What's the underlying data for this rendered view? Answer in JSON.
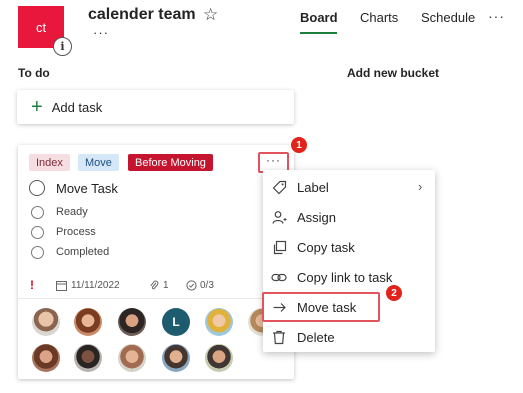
{
  "plan": {
    "initials": "ct",
    "info_glyph": "i",
    "title": "calender team",
    "star_glyph": "☆",
    "more_glyph": "···"
  },
  "tabs": [
    {
      "label": "Board",
      "active": true
    },
    {
      "label": "Charts",
      "active": false
    },
    {
      "label": "Schedule",
      "active": false
    }
  ],
  "header_more": "···",
  "bucket": {
    "name": "To do",
    "add_task_label": "Add task",
    "add_task_icon": "+"
  },
  "add_bucket_label": "Add new bucket",
  "card": {
    "labels": [
      {
        "text": "Index",
        "color": "#f5dde1"
      },
      {
        "text": "Move",
        "color": "#d6e8f8"
      },
      {
        "text": "Before Moving",
        "color": "#c4142e"
      }
    ],
    "more_glyph": "···",
    "title": "Move Task",
    "checklist": [
      "Ready",
      "Process",
      "Completed"
    ],
    "priority_glyph": "!",
    "due_date": "11/11/2022",
    "attachments": "1",
    "checklist_progress": "0/3",
    "people_initial": "L"
  },
  "callouts": [
    "1",
    "2"
  ],
  "menu": {
    "items": [
      {
        "label": "Label",
        "icon": "tag-icon"
      },
      {
        "label": "Assign",
        "icon": "person-add-icon"
      },
      {
        "label": "Copy task",
        "icon": "copy-icon"
      },
      {
        "label": "Copy link to task",
        "icon": "link-icon"
      },
      {
        "label": "Move task",
        "icon": "arrow-right-icon"
      },
      {
        "label": "Delete",
        "icon": "trash-icon"
      }
    ],
    "chevron": "›"
  },
  "colors": {
    "accent_green": "#1e7e3e",
    "plan_red": "#e8173b",
    "highlight_red": "#e0545e"
  }
}
